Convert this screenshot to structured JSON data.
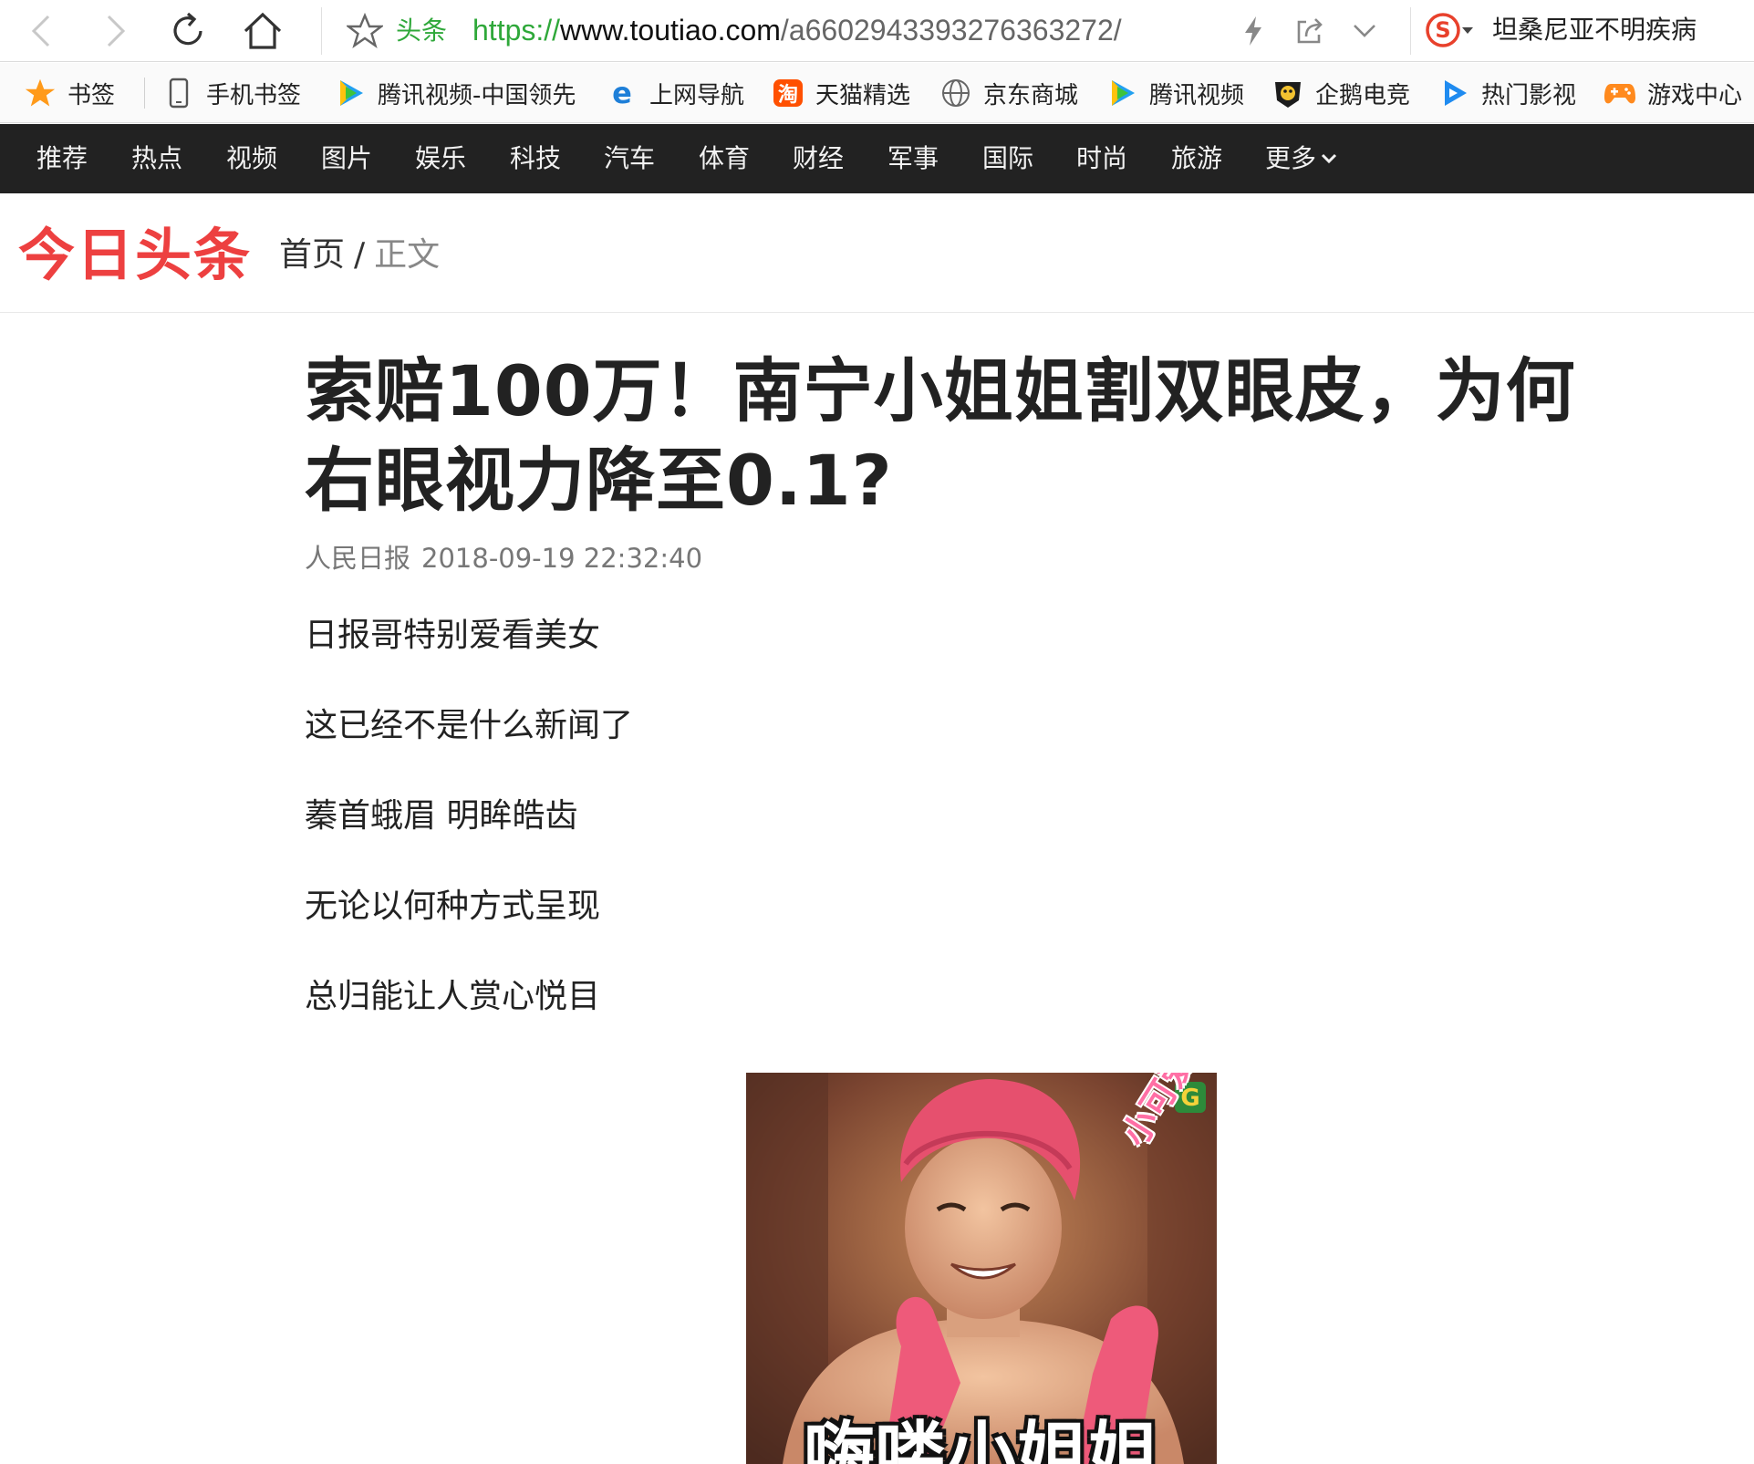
{
  "browser": {
    "site_label": "头条",
    "url_protocol": "https://",
    "url_host": "www.toutiao.com",
    "url_path": "/a6602943393276363272/",
    "search_text": "坦桑尼亚不明疾病"
  },
  "bookmarks": {
    "items": [
      {
        "label": "书签",
        "icon": "star-icon"
      },
      {
        "label": "手机书签",
        "icon": "phone-icon"
      },
      {
        "label": "腾讯视频-中国领先",
        "icon": "tencent-video-icon"
      },
      {
        "label": "上网导航",
        "icon": "ie-icon"
      },
      {
        "label": "天猫精选",
        "icon": "taobao-icon"
      },
      {
        "label": "京东商城",
        "icon": "globe-icon"
      },
      {
        "label": "腾讯视频",
        "icon": "tencent-video-icon"
      },
      {
        "label": "企鹅电竞",
        "icon": "penguin-esports-icon"
      },
      {
        "label": "热门影视",
        "icon": "play-icon"
      },
      {
        "label": "游戏中心",
        "icon": "gamepad-icon"
      }
    ]
  },
  "channels": {
    "items": [
      "推荐",
      "热点",
      "视频",
      "图片",
      "娱乐",
      "科技",
      "汽车",
      "体育",
      "财经",
      "军事",
      "国际",
      "时尚",
      "旅游"
    ],
    "more": "更多"
  },
  "header": {
    "logo_text": "今日头条",
    "breadcrumb_home": "首页",
    "breadcrumb_sep": "/",
    "breadcrumb_current": "正文"
  },
  "article": {
    "title": "索赔100万！南宁小姐姐割双眼皮，为何右眼视力降至0.1?",
    "source": "人民日报",
    "datetime": "2018-09-19 22:32:40",
    "paragraphs": [
      "日报哥特别爱看美女",
      "这已经不是什么新闻了",
      "蓁首蛾眉 明眸皓齿",
      "无论以何种方式呈现",
      "总归能让人赏心悦目"
    ],
    "image_caption": "嗨喽小姐姐",
    "image_sticker": "小可爱"
  },
  "colors": {
    "brand_red": "#ed4040",
    "nav_bg": "#222222",
    "url_green": "#2fa83a"
  }
}
